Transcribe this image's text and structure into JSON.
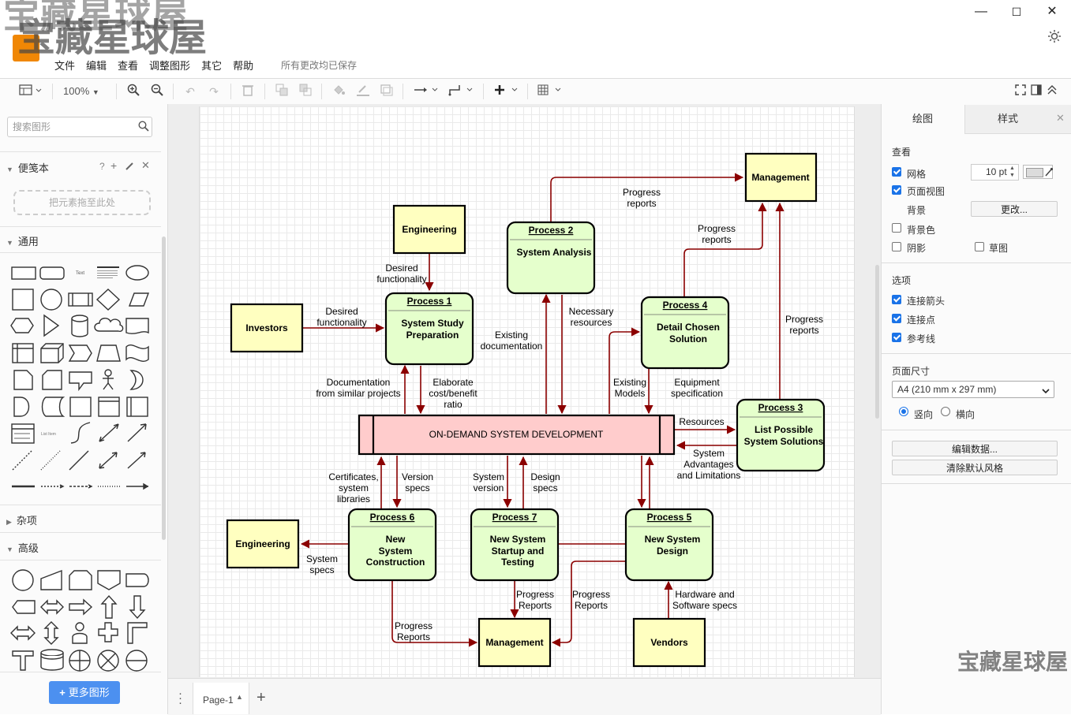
{
  "watermark": "宝藏星球屋",
  "window": {
    "minimize": "—",
    "maximize": "☐",
    "close": "✕"
  },
  "menu": [
    "文件",
    "编辑",
    "查看",
    "调整图形",
    "其它",
    "帮助"
  ],
  "save_status": "所有更改均已保存",
  "toolbar": {
    "zoom": "100%"
  },
  "sidebar": {
    "search_placeholder": "搜索图形",
    "scratchpad": "便笺本",
    "scratchpad_help": "?",
    "dropzone": "把元素拖至此处",
    "general": "通用",
    "misc": "杂项",
    "advanced": "高级",
    "more_shapes": "更多图形",
    "text_shape": "Text",
    "list_item": "List Item"
  },
  "page_tab": "Page-1",
  "rpanel": {
    "tab_diagram": "绘图",
    "tab_style": "样式",
    "view": "查看",
    "grid": "网格",
    "grid_size": "10 pt",
    "page_view": "页面视图",
    "background": "背景",
    "change": "更改...",
    "background_color": "背景色",
    "shadow": "阴影",
    "sketch": "草图",
    "options": "选项",
    "connection_arrows": "连接箭头",
    "connection_points": "连接点",
    "guides": "参考线",
    "page_size": "页面尺寸",
    "paper": "A4 (210 mm x 297 mm)",
    "portrait": "竖向",
    "landscape": "横向",
    "edit_data": "编辑数据...",
    "clear_style": "清除默认风格"
  },
  "diagram": {
    "nodes": {
      "management_top": "Management",
      "engineering_top": "Engineering",
      "investors": "Investors",
      "p1_title": "Process 1",
      "p1_body": [
        "System Study",
        "Preparation"
      ],
      "p2_title": "Process 2",
      "p2_body": [
        "System Analysis"
      ],
      "p4_title": "Process 4",
      "p4_body": [
        "Detail Chosen",
        "Solution"
      ],
      "p3_title": "Process 3",
      "p3_body": [
        "List Possible",
        "System Solutions"
      ],
      "central": "ON-DEMAND SYSTEM DEVELOPMENT",
      "p6_title": "Process 6",
      "p6_body": [
        "New",
        "System",
        "Construction"
      ],
      "p7_title": "Process 7",
      "p7_body": [
        "New System",
        "Startup and",
        "Testing"
      ],
      "p5_title": "Process 5",
      "p5_body": [
        "New System",
        "Design"
      ],
      "engineering_bottom": "Engineering",
      "management_bottom": "Management",
      "vendors": "Vendors"
    },
    "labels": {
      "progress_reports_1": [
        "Progress",
        "reports"
      ],
      "progress_reports_2": [
        "Progress",
        "reports"
      ],
      "progress_reports_3": [
        "Progress",
        "reports"
      ],
      "desired_func_1": [
        "Desired",
        "functionality"
      ],
      "desired_func_2": [
        "Desired",
        "functionality"
      ],
      "necessary_resources": [
        "Necessary",
        "resources"
      ],
      "existing_docs": [
        "Existing",
        "documentation"
      ],
      "doc_similar": [
        "Documentation",
        "from similar projects"
      ],
      "elaborate": [
        "Elaborate",
        "cost/benefit",
        "ratio"
      ],
      "existing_models": [
        "Existing",
        "Models"
      ],
      "equipment_spec": [
        "Equipment",
        "specification"
      ],
      "resources": [
        "Resources"
      ],
      "system_adv": [
        "System",
        "Advantages",
        "and Limitations"
      ],
      "certificates": [
        "Certificates,",
        "system",
        "libraries"
      ],
      "version_specs": [
        "Version",
        "specs"
      ],
      "system_version": [
        "System",
        "version"
      ],
      "design_specs": [
        "Design",
        "specs"
      ],
      "system_specs": [
        "System",
        "specs"
      ],
      "progress_reports_4": [
        "Progress",
        "Reports"
      ],
      "progress_reports_5": [
        "Progress",
        "Reports"
      ],
      "progress_reports_6": [
        "Progress",
        "Reports"
      ],
      "hw_sw": [
        "Hardware and",
        "Software specs"
      ]
    }
  }
}
